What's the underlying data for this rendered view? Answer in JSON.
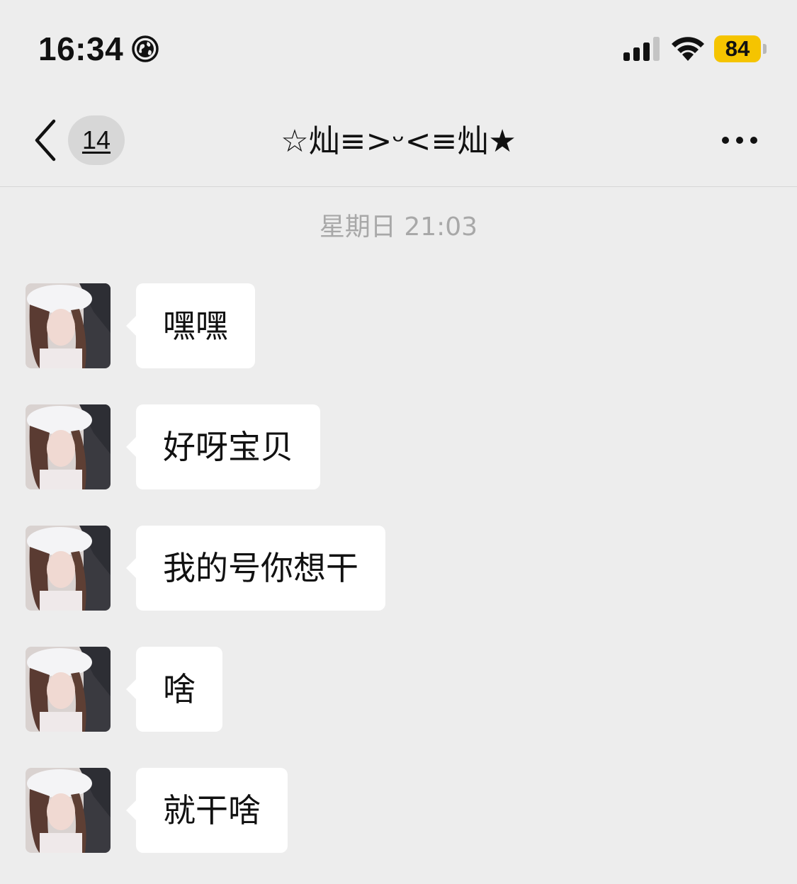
{
  "status_bar": {
    "time": "16:34",
    "location_icon": "globe-icon",
    "signal_icon": "cellular-signal-icon",
    "wifi_icon": "wifi-icon",
    "battery_level": "84",
    "battery_color": "#f5c400"
  },
  "nav": {
    "back_icon": "chevron-left-icon",
    "unread_count": "14",
    "title": "☆灿≡>ᵕ<≡灿★",
    "more_icon": "more-dots-icon"
  },
  "chat": {
    "timestamp": "星期日 21:03",
    "messages": [
      {
        "sender": "other",
        "text": "嘿嘿"
      },
      {
        "sender": "other",
        "text": "好呀宝贝"
      },
      {
        "sender": "other",
        "text": "我的号你想干"
      },
      {
        "sender": "other",
        "text": "啥"
      },
      {
        "sender": "other",
        "text": "就干啥"
      }
    ]
  },
  "colors": {
    "background": "#ededed",
    "bubble": "#ffffff",
    "timestamp": "#a8a8a8"
  }
}
